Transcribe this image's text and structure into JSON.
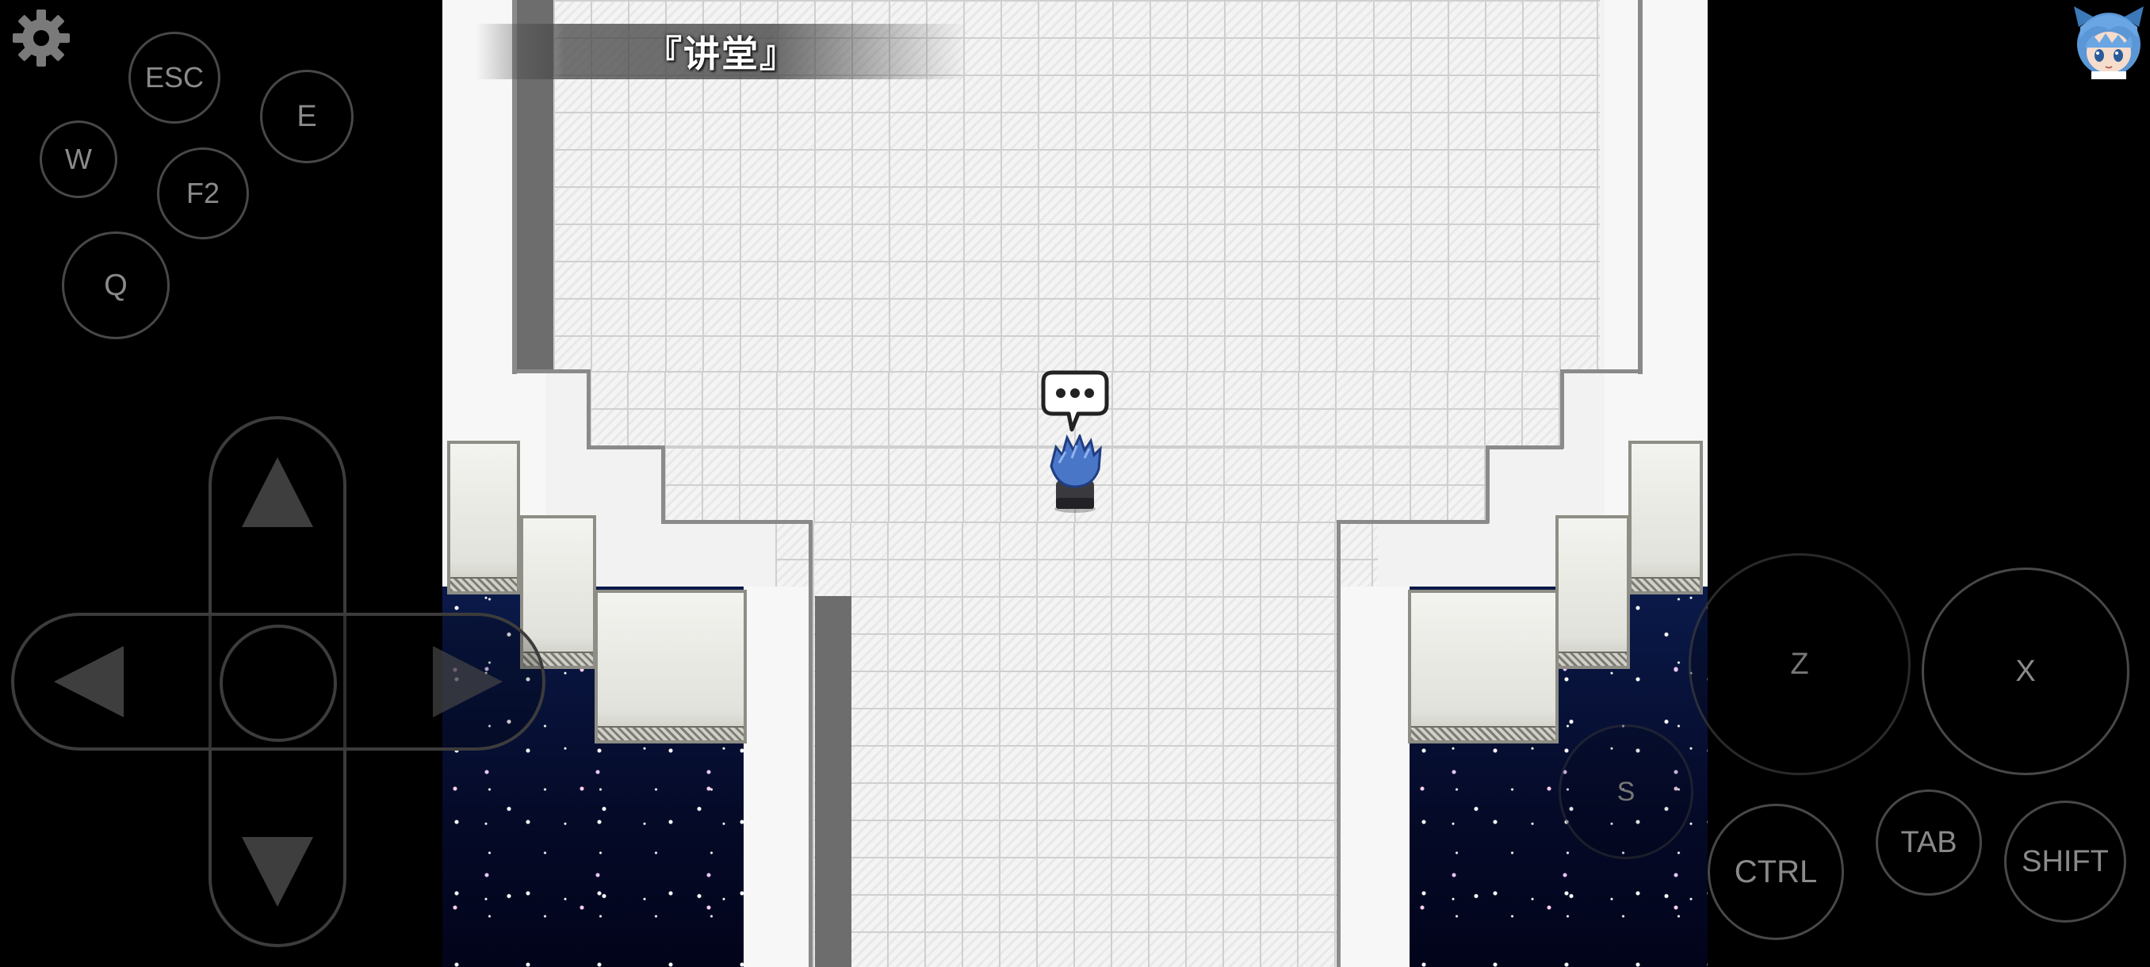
{
  "map": {
    "title": "『讲堂』"
  },
  "controls": {
    "buttons": {
      "esc": "ESC",
      "e": "E",
      "w": "W",
      "f2": "F2",
      "q": "Q",
      "z": "Z",
      "x": "X",
      "s": "S",
      "ctrl": "CTRL",
      "tab": "TAB",
      "shift": "SHIFT"
    },
    "icons": {
      "settings": "gear-icon",
      "avatar": "character-avatar-icon",
      "up": "arrow-up-icon",
      "down": "arrow-down-icon",
      "left": "arrow-left-icon",
      "right": "arrow-right-icon"
    }
  },
  "colors": {
    "background": "#000000",
    "floor": "#f4f4f4",
    "space": "#0a1a4a",
    "control_outline": "#3c3c3c",
    "control_text": "#8a8a8a"
  }
}
